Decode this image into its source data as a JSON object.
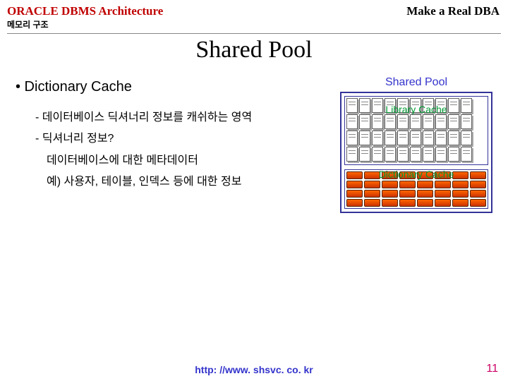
{
  "header": {
    "left": "ORACLE DBMS Architecture",
    "right": "Make a Real DBA",
    "subtitle": "메모리 구조"
  },
  "title": "Shared Pool",
  "body": {
    "heading": "•  Dictionary Cache",
    "line1": "- 데이터베이스 딕셔너리 정보를 캐쉬하는 영역",
    "line2": "- 딕셔너리 정보?",
    "line3": "데이터베이스에 대한 메타데이터",
    "line4": "예) 사용자, 테이블, 인덱스 등에 대한 정보"
  },
  "diagram": {
    "title": "Shared Pool",
    "lib_label": "Library Cache",
    "dict_label": "Dictionary Cache"
  },
  "footer": {
    "url": "http: //www. shsvc. co. kr",
    "page": "11"
  }
}
